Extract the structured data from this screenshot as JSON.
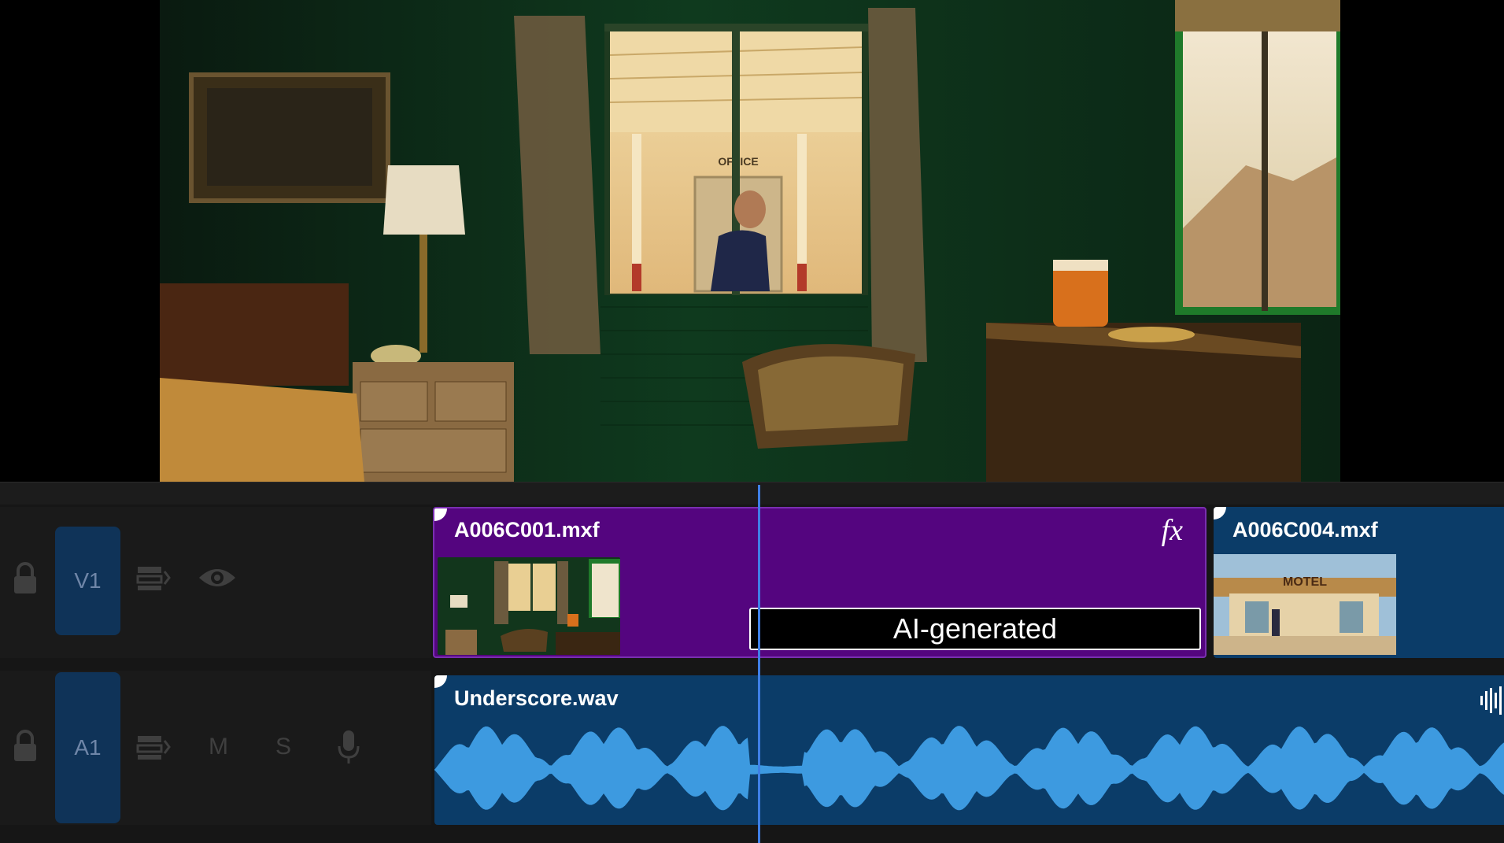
{
  "timeline": {
    "tracks": {
      "video": {
        "label": "V1"
      },
      "audio": {
        "label": "A1",
        "mute": "M",
        "solo": "S"
      }
    },
    "clips": {
      "video_1": {
        "name": "A006C001.mxf",
        "fx": "fx"
      },
      "video_2": {
        "name": "A006C004.mxf",
        "thumbnail_sign": "MOTEL"
      },
      "audio": {
        "name": "Underscore.wav"
      }
    },
    "overlay_label": "AI-generated"
  },
  "viewer": {
    "scene_sign": "OFFICE"
  },
  "colors": {
    "video_clip_fx": "#54057f",
    "clip_blue": "#0b3c68",
    "waveform": "#3d9ae0",
    "playhead": "#3f7fe6",
    "track_label": "#0f3358"
  },
  "icons": [
    "lock-icon",
    "sync-lock-icon",
    "eye-icon",
    "microphone-icon",
    "waveform-icon",
    "fx-icon"
  ]
}
